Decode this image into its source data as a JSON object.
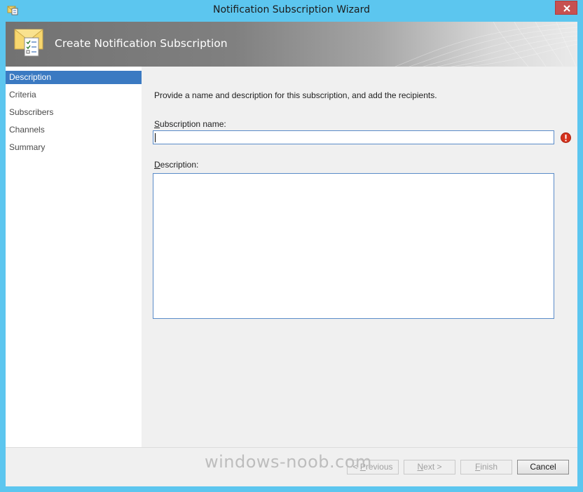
{
  "window": {
    "title": "Notification Subscription Wizard",
    "accent_color": "#5cc6ef",
    "close_color": "#c75050"
  },
  "banner": {
    "title": "Create Notification Subscription",
    "icon": "envelope-checklist-icon"
  },
  "steps": {
    "items": [
      {
        "label": "Description",
        "active": true
      },
      {
        "label": "Criteria",
        "active": false
      },
      {
        "label": "Subscribers",
        "active": false
      },
      {
        "label": "Channels",
        "active": false
      },
      {
        "label": "Summary",
        "active": false
      }
    ],
    "active_color": "#3b7ac2"
  },
  "form": {
    "intro": "Provide a name and description for this subscription, and add the recipients.",
    "name_label_key": "S",
    "name_label_rest": "ubscription name:",
    "name_value": "",
    "name_error_icon": "error-icon",
    "desc_label_key": "D",
    "desc_label_rest": "escription:",
    "desc_value": ""
  },
  "footer": {
    "previous_key": "P",
    "previous_prefix": "< ",
    "previous_rest": "revious",
    "next_key": "N",
    "next_rest": "ext >",
    "finish_key": "F",
    "finish_rest": "inish",
    "cancel_label": "Cancel"
  },
  "watermark": "windows-noob.com"
}
